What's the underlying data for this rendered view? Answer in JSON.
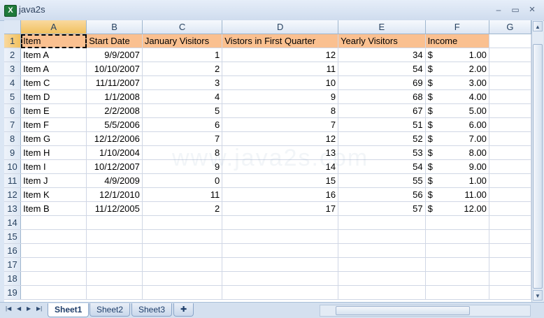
{
  "window": {
    "title": "java2s",
    "minimize": "–",
    "maximize": "▭",
    "close": "×"
  },
  "columns": [
    "A",
    "B",
    "C",
    "D",
    "E",
    "F",
    "G"
  ],
  "rows": [
    "1",
    "2",
    "3",
    "4",
    "5",
    "6",
    "7",
    "8",
    "9",
    "10",
    "11",
    "12",
    "13",
    "14",
    "15",
    "16",
    "17",
    "18",
    "19"
  ],
  "headers": [
    "Item",
    "Start Date",
    "January Visitors",
    "Vistors in First Quarter",
    "Yearly Visitors",
    "Income"
  ],
  "data": [
    [
      "Item A",
      "9/9/2007",
      "1",
      "12",
      "34",
      "$",
      "1.00"
    ],
    [
      "Item A",
      "10/10/2007",
      "2",
      "11",
      "54",
      "$",
      "2.00"
    ],
    [
      "Item C",
      "11/11/2007",
      "3",
      "10",
      "69",
      "$",
      "3.00"
    ],
    [
      "Item D",
      "1/1/2008",
      "4",
      "9",
      "68",
      "$",
      "4.00"
    ],
    [
      "Item E",
      "2/2/2008",
      "5",
      "8",
      "67",
      "$",
      "5.00"
    ],
    [
      "Item F",
      "5/5/2006",
      "6",
      "7",
      "51",
      "$",
      "6.00"
    ],
    [
      "Item G",
      "12/12/2006",
      "7",
      "12",
      "52",
      "$",
      "7.00"
    ],
    [
      "Item H",
      "1/10/2004",
      "8",
      "13",
      "53",
      "$",
      "8.00"
    ],
    [
      "Item I",
      "10/12/2007",
      "9",
      "14",
      "54",
      "$",
      "9.00"
    ],
    [
      "Item J",
      "4/9/2009",
      "0",
      "15",
      "55",
      "$",
      "1.00"
    ],
    [
      "Item K",
      "12/1/2010",
      "11",
      "16",
      "56",
      "$",
      "11.00"
    ],
    [
      "Item B",
      "11/12/2005",
      "2",
      "17",
      "57",
      "$",
      "12.00"
    ]
  ],
  "sheets": {
    "tab1": "Sheet1",
    "tab2": "Sheet2",
    "tab3": "Sheet3"
  },
  "active_cell": "A1",
  "watermark": "www.java2s.com",
  "colors": {
    "header_fill": "#fac090",
    "selection": "#f1c15f",
    "grid": "#d0d7e5"
  }
}
